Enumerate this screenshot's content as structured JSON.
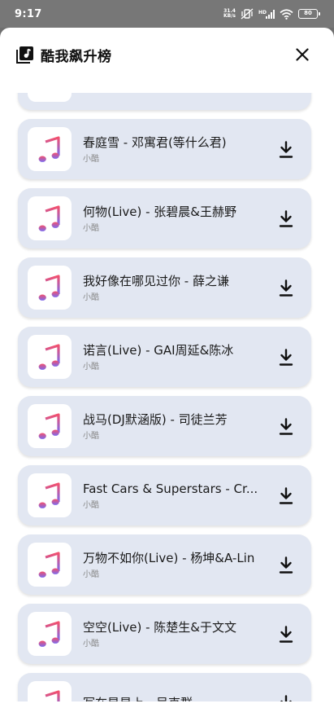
{
  "status_bar": {
    "time": "9:17",
    "net_speed_value": "31.4",
    "net_speed_unit": "KB/s",
    "battery": "80"
  },
  "sheet": {
    "title": "酷我飙升榜",
    "header_icon": "music-note-icon",
    "close_icon": "close-icon"
  },
  "tracks": [
    {
      "title": "",
      "artist": ""
    },
    {
      "title": "春庭雪 - 邓寓君(等什么君)",
      "artist": "小酷"
    },
    {
      "title": "何物(Live) - 张碧晨&王赫野",
      "artist": "小酷"
    },
    {
      "title": "我好像在哪见过你 - 薛之谦",
      "artist": "小酷"
    },
    {
      "title": "诺言(Live) - GAI周延&陈冰",
      "artist": "小酷"
    },
    {
      "title": "战马(DJ默涵版) - 司徒兰芳",
      "artist": "小酷"
    },
    {
      "title": "Fast Cars & Superstars - Cr...",
      "artist": "小酷"
    },
    {
      "title": "万物不如你(Live) - 杨坤&A-Lin",
      "artist": "小酷"
    },
    {
      "title": "空空(Live) - 陈楚生&于文文",
      "artist": "小酷"
    },
    {
      "title": "写在星星上 - 吴克群",
      "artist": ""
    }
  ],
  "colors": {
    "card_bg": "#e2e7f2",
    "status_bar_bg": "#777777",
    "note_gradient_top": "#f2506e",
    "note_gradient_bottom": "#7a6cf0"
  }
}
